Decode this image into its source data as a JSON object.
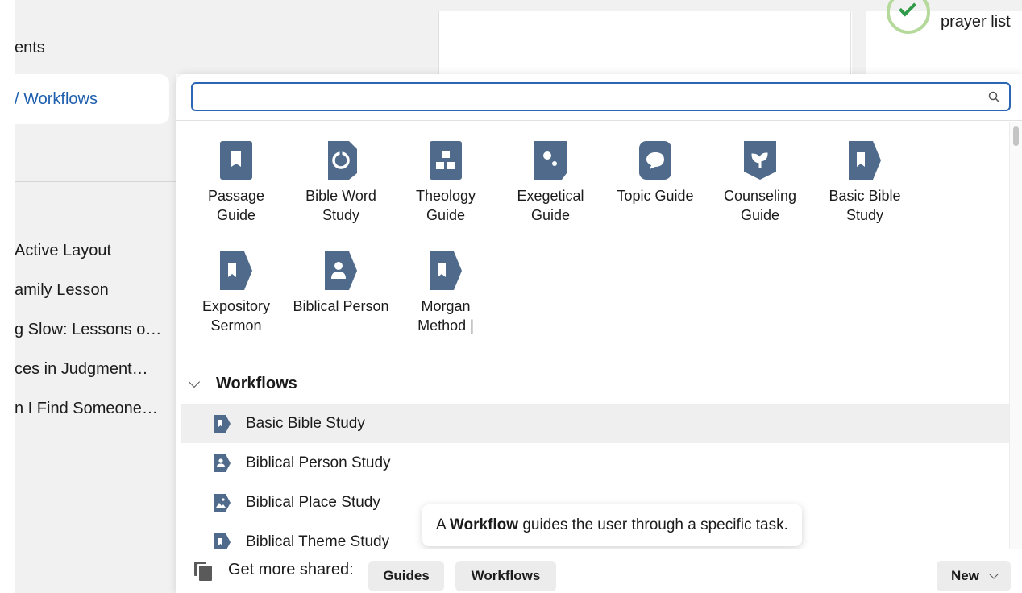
{
  "background": {
    "sidebar_items": [
      "ents",
      "/ Workflows",
      "Active Layout",
      "amily Lesson",
      "g Slow: Lessons o…",
      "ces in Judgment…",
      "n I Find Someone…"
    ],
    "prayer_label": "prayer list"
  },
  "search": {
    "value": "",
    "placeholder": ""
  },
  "guides": [
    {
      "label": "Passage Guide",
      "icon": "bookmark-icon"
    },
    {
      "label": "Bible Word Study",
      "icon": "bible-word-icon"
    },
    {
      "label": "Theology Guide",
      "icon": "theology-icon"
    },
    {
      "label": "Exegetical Guide",
      "icon": "exegetical-icon"
    },
    {
      "label": "Topic Guide",
      "icon": "speech-bubble-icon"
    },
    {
      "label": "Counseling Guide",
      "icon": "sprout-icon"
    },
    {
      "label": "Basic Bible Study",
      "icon": "bookmark-tag-icon"
    },
    {
      "label": "Expository Sermon",
      "icon": "bookmark-tag-icon"
    },
    {
      "label": "Biblical Person",
      "icon": "person-tag-icon"
    },
    {
      "label": "Morgan Method |",
      "icon": "bookmark-tag-icon"
    }
  ],
  "workflows": {
    "title": "Workflows",
    "items": [
      {
        "label": "Basic Bible Study",
        "icon": "bookmark-tag-icon",
        "highlighted": true
      },
      {
        "label": "Biblical Person Study",
        "icon": "person-tag-icon",
        "highlighted": false
      },
      {
        "label": "Biblical Place Study",
        "icon": "map-tag-icon",
        "highlighted": false
      },
      {
        "label": "Biblical Theme Study",
        "icon": "bookmark-tag-icon",
        "highlighted": false
      }
    ]
  },
  "tooltip": {
    "prefix": "A",
    "bold": "Workflow",
    "suffix": "guides the user through a specific task."
  },
  "footer": {
    "get_more_label": "Get more shared:",
    "guides_button": "Guides",
    "workflows_button": "Workflows",
    "new_button": "New"
  },
  "colors": {
    "accent": "#2b66b4",
    "icon_fill": "#4f6a8a",
    "selected_text": "#1f5fae"
  }
}
